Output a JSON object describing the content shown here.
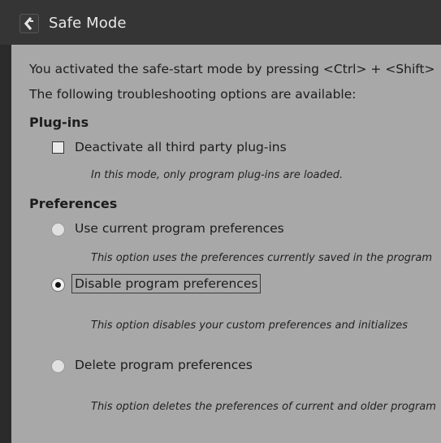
{
  "window": {
    "title": "Safe Mode",
    "logo_icon": "cubase-logo-icon"
  },
  "intro": {
    "line1": "You activated the safe-start mode by pressing <Ctrl> + <Shift>",
    "line2": "The following troubleshooting options are available:"
  },
  "plugins": {
    "heading": "Plug-ins",
    "checkbox_label": "Deactivate all third party plug-ins",
    "checked": false,
    "description": "In this mode, only program plug-ins are loaded."
  },
  "preferences": {
    "heading": "Preferences",
    "options": [
      {
        "label": "Use current program preferences",
        "description": "This option uses the preferences currently saved in the program",
        "selected": false
      },
      {
        "label": "Disable program preferences",
        "description": "This option disables your custom preferences and initializes",
        "selected": true
      },
      {
        "label": "Delete program preferences",
        "description": "This option deletes the preferences of current and older program",
        "selected": false
      }
    ]
  },
  "colors": {
    "titlebar": "#353535",
    "frame": "#2b2b2b",
    "content_bg": "#a8a8a8"
  }
}
